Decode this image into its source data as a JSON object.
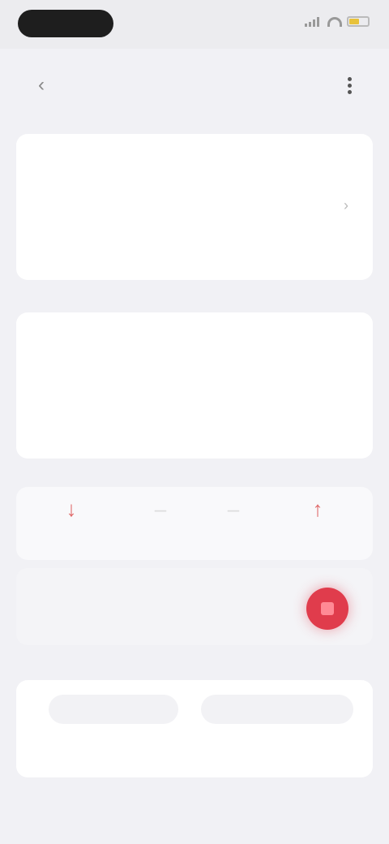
{
  "status_bar": {
    "time": "",
    "signal_icon": "signal-icon",
    "wifi_icon": "wifi-icon",
    "battery_icon": "battery-icon"
  },
  "nav": {
    "title": "",
    "back_icon": "chevron-left-icon",
    "more_icon": "more-vertical-icon"
  },
  "account_card": {
    "label_top": "",
    "row_label": "",
    "row_icon": "chevron-right-icon",
    "label_bottom": ""
  },
  "transactions": [
    {
      "label": "",
      "amount": ""
    },
    {
      "label": "",
      "amount": ""
    },
    {
      "label": "",
      "amount": ""
    }
  ],
  "stats": [
    {
      "icon": "arrow-down-icon",
      "value": ""
    },
    {
      "icon": "dash-icon",
      "value": ""
    },
    {
      "icon": "dash-icon",
      "value": ""
    },
    {
      "icon": "arrow-up-icon",
      "value": ""
    }
  ],
  "record": {
    "label": "",
    "button_icon": "stop-record-icon"
  },
  "options": {
    "section_title": "",
    "left_button": "",
    "right_button": "",
    "note": ""
  },
  "colors": {
    "accent": "#e03c4c",
    "amount": "#e06a6a",
    "background": "#f1f1f5"
  }
}
